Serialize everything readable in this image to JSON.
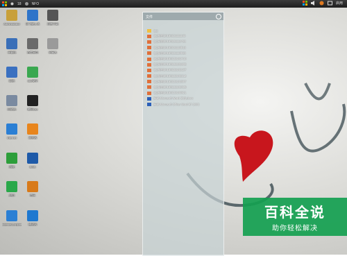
{
  "topbar": {
    "left_items": [
      {
        "icon": "start-menu-icon",
        "text": ""
      },
      {
        "icon": "sun-icon",
        "text": "18"
      },
      {
        "icon": "weather-icon",
        "text": "NFO"
      }
    ],
    "right_items": [
      {
        "icon": "network-icon"
      },
      {
        "icon": "volume-icon"
      },
      {
        "icon": "app-icon"
      },
      {
        "icon": "tray-icon"
      },
      {
        "icon": "tray-icon-2"
      }
    ],
    "right_text": "启用"
  },
  "desktop_icons": [
    {
      "name": "my-computer",
      "label": "Administrator",
      "color": "#c8a03a"
    },
    {
      "name": "iflytek",
      "label": "讯飞输入法",
      "color": "#2e74c9"
    },
    {
      "name": "download",
      "label": "迅雷下载",
      "color": "#555555"
    },
    {
      "name": "computer",
      "label": "计算机",
      "color": "#3a6fb8"
    },
    {
      "name": "cloud",
      "label": "百度网盘",
      "color": "#6a6a6a"
    },
    {
      "name": "file",
      "label": "记事本",
      "color": "#9a9a9a"
    },
    {
      "name": "network",
      "label": "网络",
      "color": "#3a70c0"
    },
    {
      "name": "security",
      "label": "360安全",
      "color": "#3aa850"
    },
    {
      "name": "recycle-bin",
      "label": "回收站",
      "color": "#7a8aa0"
    },
    {
      "name": "qq",
      "label": "腾讯QQ",
      "color": "#222222"
    },
    {
      "name": "ie",
      "label": "Internet",
      "color": "#2b7fd4"
    },
    {
      "name": "browser",
      "label": "浏览器",
      "color": "#e8851c"
    },
    {
      "name": "game",
      "label": "游戏",
      "color": "#2d9e3a"
    },
    {
      "name": "ems",
      "label": "EMS",
      "color": "#1e5aa8"
    },
    {
      "name": "green-app",
      "label": "应用",
      "color": "#2aa84a"
    },
    {
      "name": "music",
      "label": "音乐",
      "color": "#d87a1a"
    },
    {
      "name": "internet-explorer",
      "label": "Internet Explorer",
      "color": "#2b7fd4"
    },
    {
      "name": "player",
      "label": "播放器",
      "color": "#1e78d0"
    }
  ],
  "panel": {
    "title": "文件",
    "files": [
      {
        "type": "folder",
        "name": "QQ"
      },
      {
        "type": "image",
        "name": "QQ截图20150221111133"
      },
      {
        "type": "image",
        "name": "QQ截图20150221112422"
      },
      {
        "type": "image",
        "name": "QQ截图20150221113516"
      },
      {
        "type": "image",
        "name": "QQ截图20150221113826"
      },
      {
        "type": "image",
        "name": "QQ截图20150222101710"
      },
      {
        "type": "image",
        "name": "QQ截图20150222101832"
      },
      {
        "type": "image",
        "name": "QQ截图20150222102157"
      },
      {
        "type": "image",
        "name": "QQ截图20150222102212"
      },
      {
        "type": "image",
        "name": "QQ截图20150222102507"
      },
      {
        "type": "image",
        "name": "QQ截图20150222102628"
      },
      {
        "type": "image",
        "name": "QQ截图20150222103521"
      },
      {
        "type": "doc",
        "name": "新建 Microsoft Word 文档.docx"
      },
      {
        "type": "doc",
        "name": "新建 Microsoft Office Word 97-2003"
      }
    ]
  },
  "watermark": {
    "title": "百科全说",
    "subtitle": "助你轻松解决"
  }
}
